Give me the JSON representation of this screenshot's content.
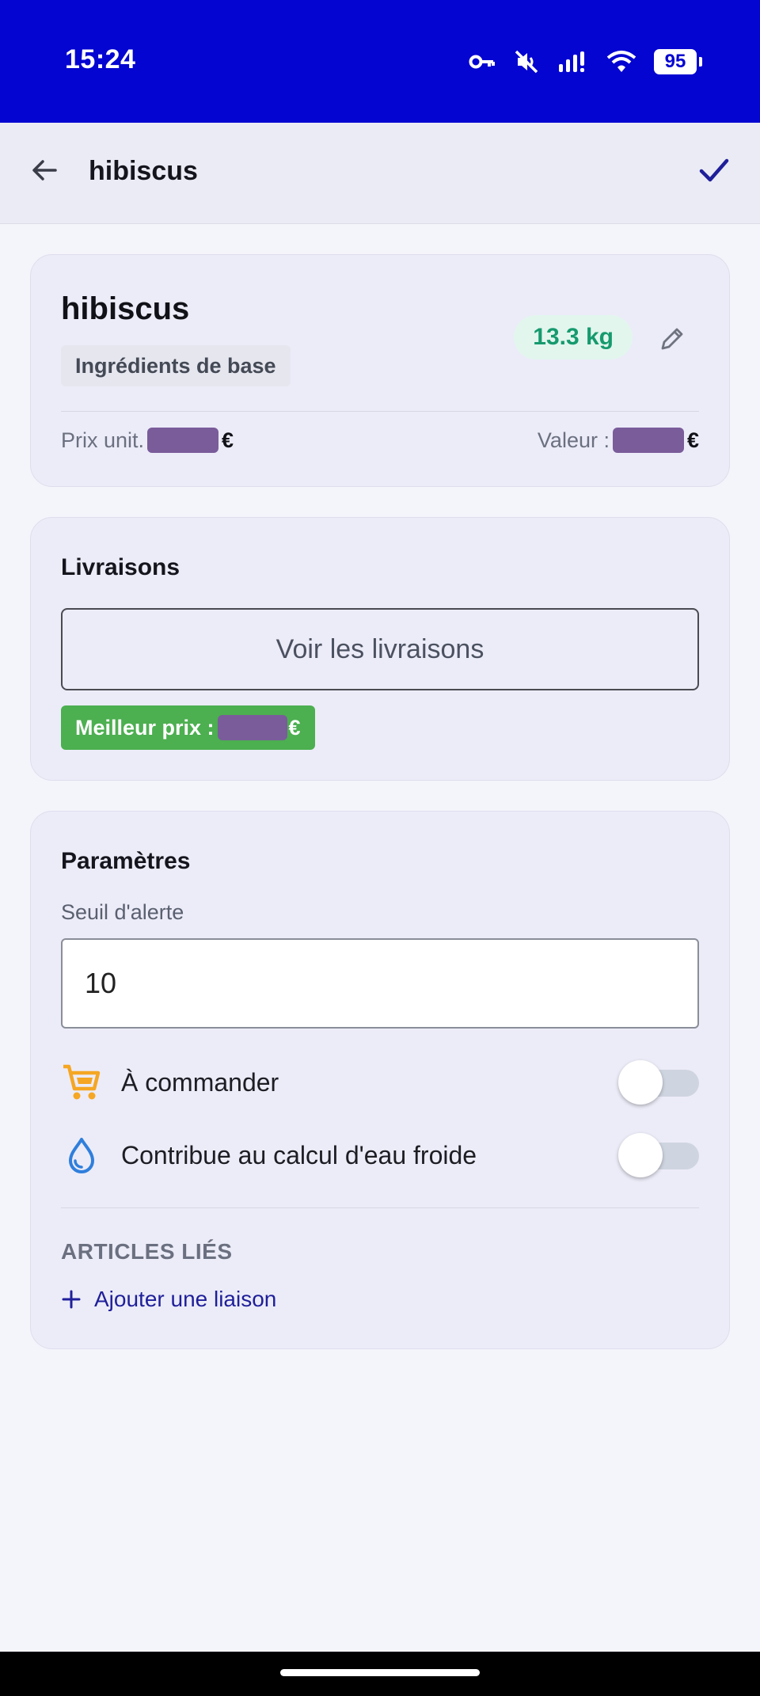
{
  "status_bar": {
    "time": "15:24",
    "battery": "95",
    "icons": [
      "vpn-key-icon",
      "mute-icon",
      "signal-icon",
      "wifi-icon",
      "battery-icon"
    ]
  },
  "app_bar": {
    "title": "hibiscus",
    "back_icon": "arrow-left-icon",
    "confirm_icon": "check-icon"
  },
  "item": {
    "name": "hibiscus",
    "category": "Ingrédients de base",
    "quantity": "13.3 kg",
    "unit_price_label": "Prix unit.",
    "value_label": "Valeur :",
    "currency": "€"
  },
  "deliveries": {
    "title": "Livraisons",
    "button_label": "Voir les livraisons",
    "best_price_label": "Meilleur prix :",
    "currency": "€"
  },
  "settings": {
    "title": "Paramètres",
    "alert_threshold_label": "Seuil d'alerte",
    "alert_threshold_value": "10",
    "to_order_label": "À commander",
    "to_order_on": false,
    "cold_water_label": "Contribue au calcul d'eau froide",
    "cold_water_on": false,
    "linked_articles_heading": "ARTICLES LIÉS",
    "add_link_label": "Ajouter une liaison"
  },
  "colors": {
    "status_bar": "#0505d1",
    "accent": "#1f1f9a",
    "quantity_text": "#169a6e",
    "quantity_bg": "#e2f6ee",
    "best_price_bg": "#4caf50",
    "cart_icon": "#f5a623",
    "water_icon": "#2f7fdc"
  }
}
